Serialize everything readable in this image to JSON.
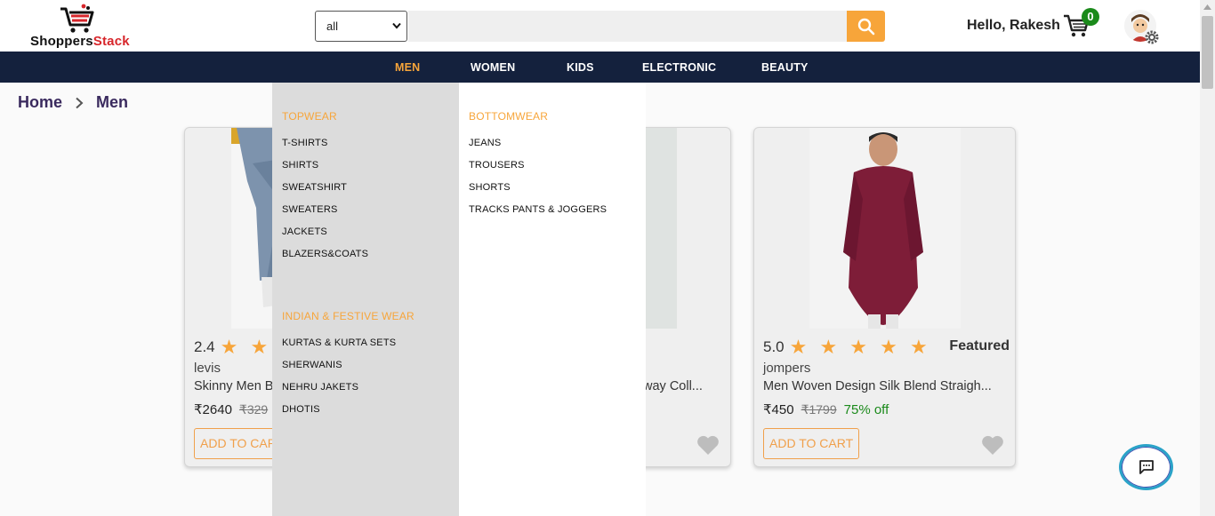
{
  "app": {
    "logo_main": "Shoppers",
    "logo_accent": "Stack"
  },
  "header": {
    "category_selected": "all",
    "search_placeholder": "",
    "greeting": "Hello, Rakesh",
    "cart_count": "0"
  },
  "nav": {
    "items": [
      {
        "label": "MEN",
        "active": true
      },
      {
        "label": "WOMEN",
        "active": false
      },
      {
        "label": "KIDS",
        "active": false
      },
      {
        "label": "ELECTRONIC",
        "active": false
      },
      {
        "label": "BEAUTY",
        "active": false
      }
    ]
  },
  "breadcrumb": {
    "home": "Home",
    "current": "Men"
  },
  "mega_menu": {
    "topwear": {
      "heading": "TOPWEAR",
      "links": [
        "T-SHIRTS",
        "SHIRTS",
        "SWEATSHIRT",
        "SWEATERS",
        "JACKETS",
        "BLAZERS&COATS"
      ]
    },
    "indian": {
      "heading": "INDIAN & FESTIVE WEAR",
      "links": [
        "KURTAS & KURTA SETS",
        "SHERWANIS",
        "NEHRU JAKETS",
        "DHOTIS"
      ]
    },
    "bottomwear": {
      "heading": "BOTTOMWEAR",
      "links": [
        "JEANS",
        "TROUSERS",
        "SHORTS",
        "TRACKS PANTS & JOGGERS"
      ]
    }
  },
  "products": [
    {
      "rating": "2.4",
      "stars": "★ ★ ★",
      "brand": "levis",
      "name": "Skinny Men B",
      "price": "₹2640",
      "mrp": "₹329",
      "discount": "",
      "featured": "",
      "add_label": "ADD TO CART"
    },
    {
      "name_tail": "way Coll..."
    },
    {
      "rating": "5.0",
      "stars": "★ ★ ★ ★ ★",
      "brand": "jompers",
      "name": "Men Woven Design Silk Blend Straigh...",
      "price": "₹450",
      "mrp": "₹1799",
      "discount": "75% off",
      "featured": "Featured",
      "add_label": "ADD TO CART"
    }
  ],
  "colors": {
    "accent": "#f7a53a",
    "nav_bg": "#14213d",
    "discount": "#1b8a1b",
    "badge": "#1b8a1b",
    "logo_red": "#d7262b"
  },
  "icons": {
    "search": "search-icon",
    "cart": "cart-icon",
    "settings": "gear-icon",
    "heart": "heart-icon",
    "chat": "chat-icon"
  }
}
